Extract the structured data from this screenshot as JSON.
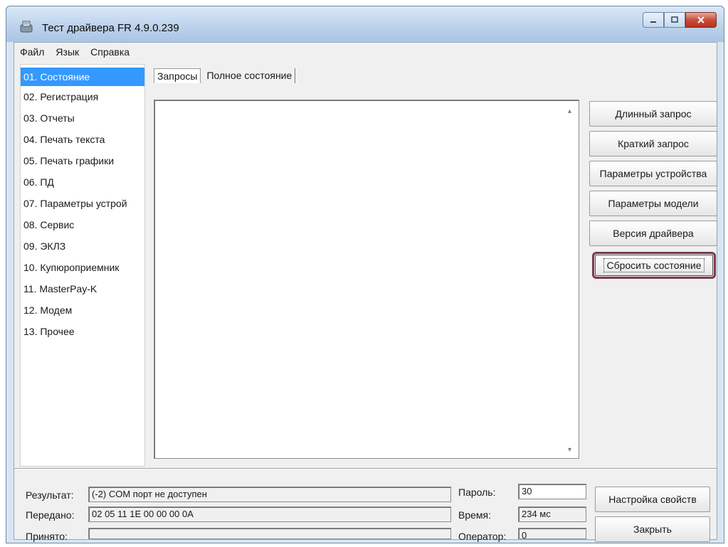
{
  "window": {
    "title": "Тест драйвера FR 4.9.0.239"
  },
  "menu": {
    "file": "Файл",
    "language": "Язык",
    "help": "Справка"
  },
  "sidebar": {
    "items": [
      "01. Состояние",
      "02. Регистрация",
      "03. Отчеты",
      "04. Печать текста",
      "05. Печать графики",
      "06. ПД",
      "07. Параметры устрой",
      "08. Сервис",
      "09. ЭКЛЗ",
      "10. Купюроприемник",
      "11. MasterPay-K",
      "12. Модем",
      "13. Прочее"
    ],
    "selected_index": 0
  },
  "tabs": {
    "requests": "Запросы",
    "full_state": "Полное состояние",
    "active": "requests"
  },
  "buttons": {
    "long_request": "Длинный запрос",
    "short_request": "Краткий запрос",
    "device_params": "Параметры устройства",
    "model_params": "Параметры модели",
    "driver_version": "Версия драйвера",
    "reset_state": "Сбросить состояние",
    "settings": "Настройка свойств",
    "close": "Закрыть"
  },
  "status": {
    "result_label": "Результат:",
    "result_value": "(-2) COM порт не доступен",
    "sent_label": "Передано:",
    "sent_value": "02 05 11 1E 00 00 00 0A",
    "received_label": "Принято:",
    "received_value": ""
  },
  "fields": {
    "password_label": "Пароль:",
    "password_value": "30",
    "time_label": "Время:",
    "time_value": "234 мс",
    "operator_label": "Оператор:",
    "operator_value": "0"
  },
  "colors": {
    "selection": "#3399ff",
    "highlight_outline": "#7b3a4a"
  }
}
